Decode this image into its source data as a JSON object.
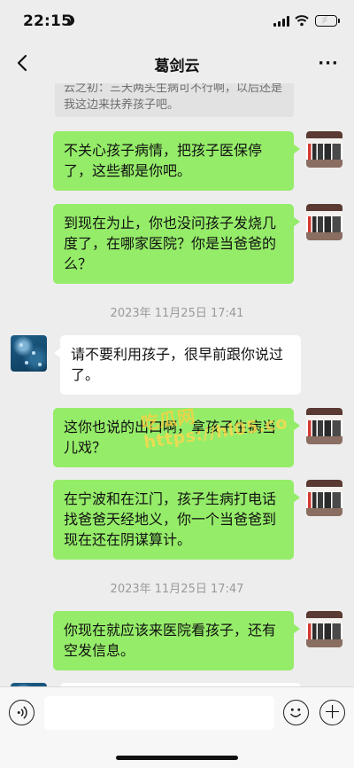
{
  "status_bar": {
    "time": "22:15",
    "icons": [
      "moon-icon",
      "signal-icon",
      "wifi-icon",
      "battery-charging-icon"
    ]
  },
  "nav": {
    "title": "葛剑云",
    "back_icon": "chevron-left-icon",
    "more_label": "···"
  },
  "quoted_message": {
    "text": "云之初：三天两头生病可不行啊，以后还是我这边来扶养孩子吧。"
  },
  "messages": [
    {
      "from": "self",
      "text": "不关心孩子病情，把孩子医保停了，这些都是你吧。"
    },
    {
      "from": "self",
      "text": "到现在为止，你也没问孩子发烧几度了，在哪家医院？你是当爸爸的么？"
    },
    {
      "from": "peer",
      "text": "请不要利用孩子，很早前跟你说过了。"
    },
    {
      "from": "self",
      "text": "这你也说的出口啊，拿孩子生病当儿戏？"
    },
    {
      "from": "self",
      "text": "在宁波和在江门，孩子生病打电话找爸爸天经地义，你一个当爸爸到现在还在阴谋算计。"
    },
    {
      "from": "self",
      "text": "你现在就应该来医院看孩子，还有空发信息。"
    }
  ],
  "timestamps": [
    "2023年 11月25日 17:41",
    "2023年 11月25日 17:47"
  ],
  "watermark": {
    "line1": "吃瓜网",
    "line2": "https://hl05.co"
  },
  "input_bar": {
    "voice_icon": "voice-icon",
    "placeholder": "",
    "emoji_icon": "emoji-icon",
    "plus_label": "+"
  },
  "colors": {
    "background": "#ededed",
    "outgoing_bubble": "#95ec69",
    "incoming_bubble": "#ffffff",
    "timestamp_text": "#9a9a9a"
  }
}
